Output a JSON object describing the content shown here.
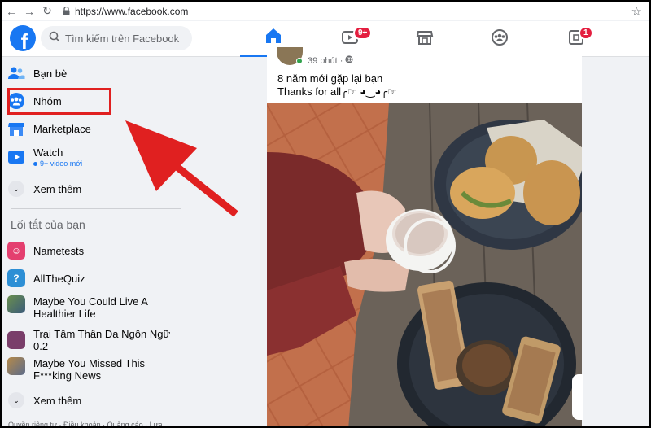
{
  "browser": {
    "url": "https://www.facebook.com"
  },
  "header": {
    "logo_letter": "f",
    "search_placeholder": "Tìm kiếm trên Facebook",
    "tabs": [
      {
        "name": "home",
        "icon": "home-icon",
        "active": true
      },
      {
        "name": "watch",
        "icon": "video-icon",
        "badge": "9+"
      },
      {
        "name": "marketplace",
        "icon": "store-icon"
      },
      {
        "name": "groups",
        "icon": "groups-icon"
      },
      {
        "name": "gaming",
        "icon": "gaming-icon",
        "badge": "1"
      }
    ],
    "accent_color": "#1877f2",
    "badge_color": "#e41e3f"
  },
  "sidebar": {
    "items": [
      {
        "label": "Bạn bè",
        "icon": "friends-icon"
      },
      {
        "label": "Nhóm",
        "icon": "groups-icon"
      },
      {
        "label": "Marketplace",
        "icon": "marketplace-icon"
      },
      {
        "label": "Watch",
        "icon": "watch-icon",
        "sub": "9+ video mới"
      },
      {
        "label": "Xem thêm",
        "icon": "chevron-down-icon"
      }
    ],
    "shortcuts_title": "Lối tắt của bạn",
    "shortcuts": [
      {
        "label": "Nametests"
      },
      {
        "label": "AllTheQuiz"
      },
      {
        "label": "Maybe You Could Live A Healthier Life"
      },
      {
        "label": "Trại Tâm Thần Đa Ngôn Ngữ 0.2"
      },
      {
        "label": "Maybe You Missed This F***king News"
      },
      {
        "label": "Xem thêm"
      }
    ],
    "footer": "Quyền riêng tư · Điều khoản · Quảng cáo · Lựa"
  },
  "post": {
    "time": "39 phút ·",
    "line1": "8 năm mới gặp lại bạn",
    "line2": "Thanks for all╭☞ ◕‿◕╭☞"
  },
  "annotation": {
    "color": "#e02020"
  }
}
